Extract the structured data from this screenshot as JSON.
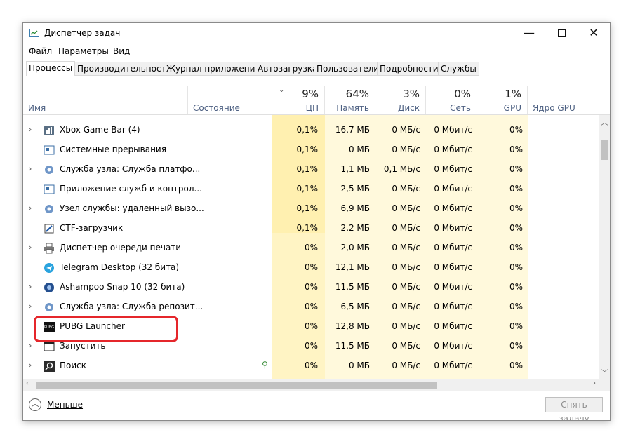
{
  "window": {
    "title": "Диспетчер задач",
    "minimize": "—",
    "close": "✕"
  },
  "menu": [
    "Файл",
    "Параметры",
    "Вид"
  ],
  "tabs": [
    {
      "label": "Процессы",
      "active": true
    },
    {
      "label": "Производительность"
    },
    {
      "label": "Журнал приложений"
    },
    {
      "label": "Автозагрузка"
    },
    {
      "label": "Пользователи"
    },
    {
      "label": "Подробности"
    },
    {
      "label": "Службы"
    }
  ],
  "columns": {
    "name": "Имя",
    "status": "Состояние",
    "cpu": {
      "pct": "9%",
      "label": "ЦП"
    },
    "memory": {
      "pct": "64%",
      "label": "Память"
    },
    "disk": {
      "pct": "3%",
      "label": "Диск"
    },
    "network": {
      "pct": "0%",
      "label": "Сеть"
    },
    "gpu": {
      "pct": "1%",
      "label": "GPU"
    },
    "gpu_engine": {
      "label": "Ядро GPU"
    }
  },
  "processes": [
    {
      "name": "Xbox Game Bar (4)",
      "expandable": true,
      "icon": "xbox-game-bar-icon",
      "cpu": "0,1%",
      "mem": "16,7 МБ",
      "disk": "0 МБ/с",
      "net": "0 Мбит/с",
      "gpu": "0%"
    },
    {
      "name": "Системные прерывания",
      "expandable": false,
      "icon": "system-interrupts-icon",
      "cpu": "0,1%",
      "mem": "0 МБ",
      "disk": "0 МБ/с",
      "net": "0 Мбит/с",
      "gpu": "0%"
    },
    {
      "name": "Служба узла: Служба платфо...",
      "expandable": true,
      "icon": "gear-icon",
      "cpu": "0,1%",
      "mem": "1,1 МБ",
      "disk": "0,1 МБ/с",
      "net": "0 Мбит/с",
      "gpu": "0%"
    },
    {
      "name": "Приложение служб и контрол...",
      "expandable": false,
      "icon": "services-app-icon",
      "cpu": "0,1%",
      "mem": "2,5 МБ",
      "disk": "0 МБ/с",
      "net": "0 Мбит/с",
      "gpu": "0%"
    },
    {
      "name": "Узел службы: удаленный вызо...",
      "expandable": true,
      "icon": "gear-icon",
      "cpu": "0,1%",
      "mem": "6,9 МБ",
      "disk": "0 МБ/с",
      "net": "0 Мбит/с",
      "gpu": "0%"
    },
    {
      "name": "CTF-загрузчик",
      "expandable": false,
      "icon": "ctf-loader-icon",
      "cpu": "0,1%",
      "mem": "2,2 МБ",
      "disk": "0 МБ/с",
      "net": "0 Мбит/с",
      "gpu": "0%"
    },
    {
      "name": "Диспетчер очереди печати",
      "expandable": true,
      "icon": "printer-icon",
      "cpu": "0%",
      "mem": "2,0 МБ",
      "disk": "0 МБ/с",
      "net": "0 Мбит/с",
      "gpu": "0%"
    },
    {
      "name": "Telegram Desktop (32 бита)",
      "expandable": false,
      "icon": "telegram-icon",
      "cpu": "0%",
      "mem": "12,1 МБ",
      "disk": "0 МБ/с",
      "net": "0 Мбит/с",
      "gpu": "0%"
    },
    {
      "name": "Ashampoo Snap 10 (32 бита)",
      "expandable": true,
      "icon": "ashampoo-snap-icon",
      "cpu": "0%",
      "mem": "11,5 МБ",
      "disk": "0 МБ/с",
      "net": "0 Мбит/с",
      "gpu": "0%"
    },
    {
      "name": "Служба узла: Служба репозит...",
      "expandable": true,
      "icon": "gear-icon",
      "cpu": "0%",
      "mem": "6,5 МБ",
      "disk": "0 МБ/с",
      "net": "0 Мбит/с",
      "gpu": "0%"
    },
    {
      "name": "PUBG Launcher",
      "expandable": false,
      "icon": "pubg-icon",
      "icon_text": "PUBG",
      "cpu": "0%",
      "mem": "12,8 МБ",
      "disk": "0 МБ/с",
      "net": "0 Мбит/с",
      "gpu": "0%"
    },
    {
      "name": "Запустить",
      "expandable": true,
      "icon": "run-icon",
      "cpu": "0%",
      "mem": "11,5 МБ",
      "disk": "0 МБ/с",
      "net": "0 Мбит/с",
      "gpu": "0%"
    },
    {
      "name": "Поиск",
      "expandable": true,
      "icon": "search-icon",
      "status_icon": "leaf-icon",
      "cpu": "0%",
      "mem": "0 МБ",
      "disk": "0 МБ/с",
      "net": "0 Мбит/с",
      "gpu": "0%"
    }
  ],
  "footer": {
    "less_label": "Меньше",
    "end_task_label": "Снять задачу"
  },
  "colors": {
    "heat_high": "#fff0b0",
    "heat_mid": "#fff4c4",
    "heat_low": "#fff9dc",
    "highlight": "#e5262b"
  }
}
